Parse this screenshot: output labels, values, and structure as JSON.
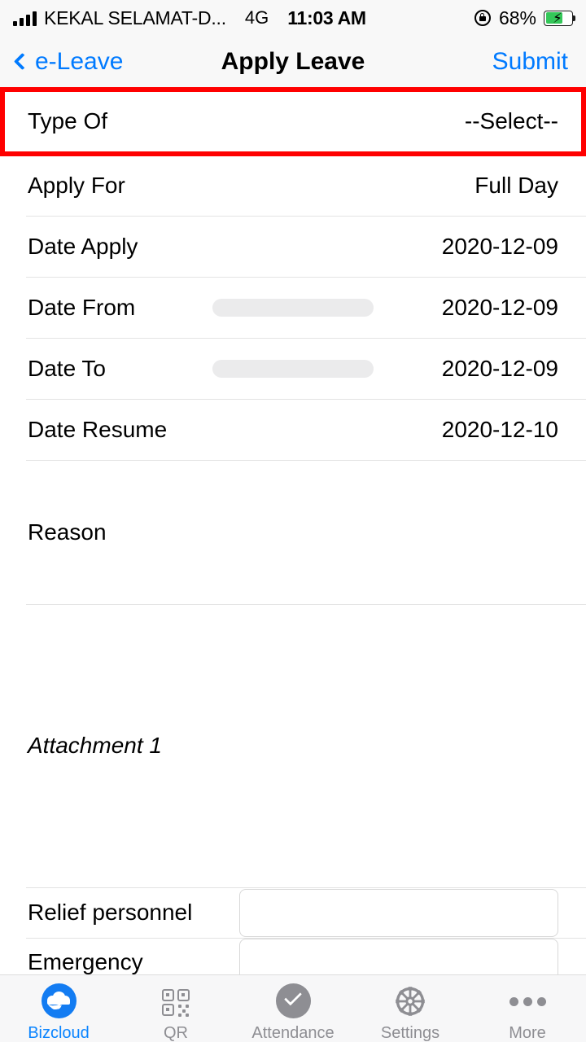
{
  "status_bar": {
    "carrier": "KEKAL SELAMAT-D...",
    "network": "4G",
    "time": "11:03 AM",
    "battery_percent": "68%",
    "rotation_lock_icon": "rotation-lock-icon",
    "battery_icon": "battery-charging-icon",
    "signal_icon": "signal-bars-icon"
  },
  "nav": {
    "back_label": "e-Leave",
    "back_icon": "chevron-left-icon",
    "title": "Apply Leave",
    "submit_label": "Submit",
    "accent_color": "#007AFF"
  },
  "form": {
    "rows": [
      {
        "label": "Type Of",
        "value": "--Select--",
        "kind": "select",
        "highlighted": true
      },
      {
        "label": "Apply For",
        "value": "Full Day",
        "kind": "select"
      },
      {
        "label": "Date Apply",
        "value": "2020-12-09",
        "kind": "date"
      },
      {
        "label": "Date From",
        "value": "2020-12-09",
        "kind": "date-pill"
      },
      {
        "label": "Date To",
        "value": "2020-12-09",
        "kind": "date-pill"
      },
      {
        "label": "Date Resume",
        "value": "2020-12-10",
        "kind": "date"
      },
      {
        "label": "Reason",
        "value": "",
        "kind": "textarea"
      },
      {
        "label": "Attachment 1",
        "value": "",
        "kind": "attachment"
      },
      {
        "label": "Relief personnel",
        "value": "",
        "kind": "textfield"
      },
      {
        "label": "Emergency",
        "value": "",
        "kind": "textfield"
      }
    ]
  },
  "annotation": {
    "highlight_color": "#FF0000",
    "target": "Type Of"
  },
  "tabbar": {
    "items": [
      {
        "label": "Bizcloud",
        "icon": "bizcloud-cloud-icon",
        "active": true
      },
      {
        "label": "QR",
        "icon": "qr-code-icon",
        "active": false
      },
      {
        "label": "Attendance",
        "icon": "check-circle-icon",
        "active": false
      },
      {
        "label": "Settings",
        "icon": "gear-icon",
        "active": false
      },
      {
        "label": "More",
        "icon": "ellipsis-icon",
        "active": false
      }
    ],
    "active_color": "#0A84FF",
    "inactive_color": "#8E8E93"
  }
}
